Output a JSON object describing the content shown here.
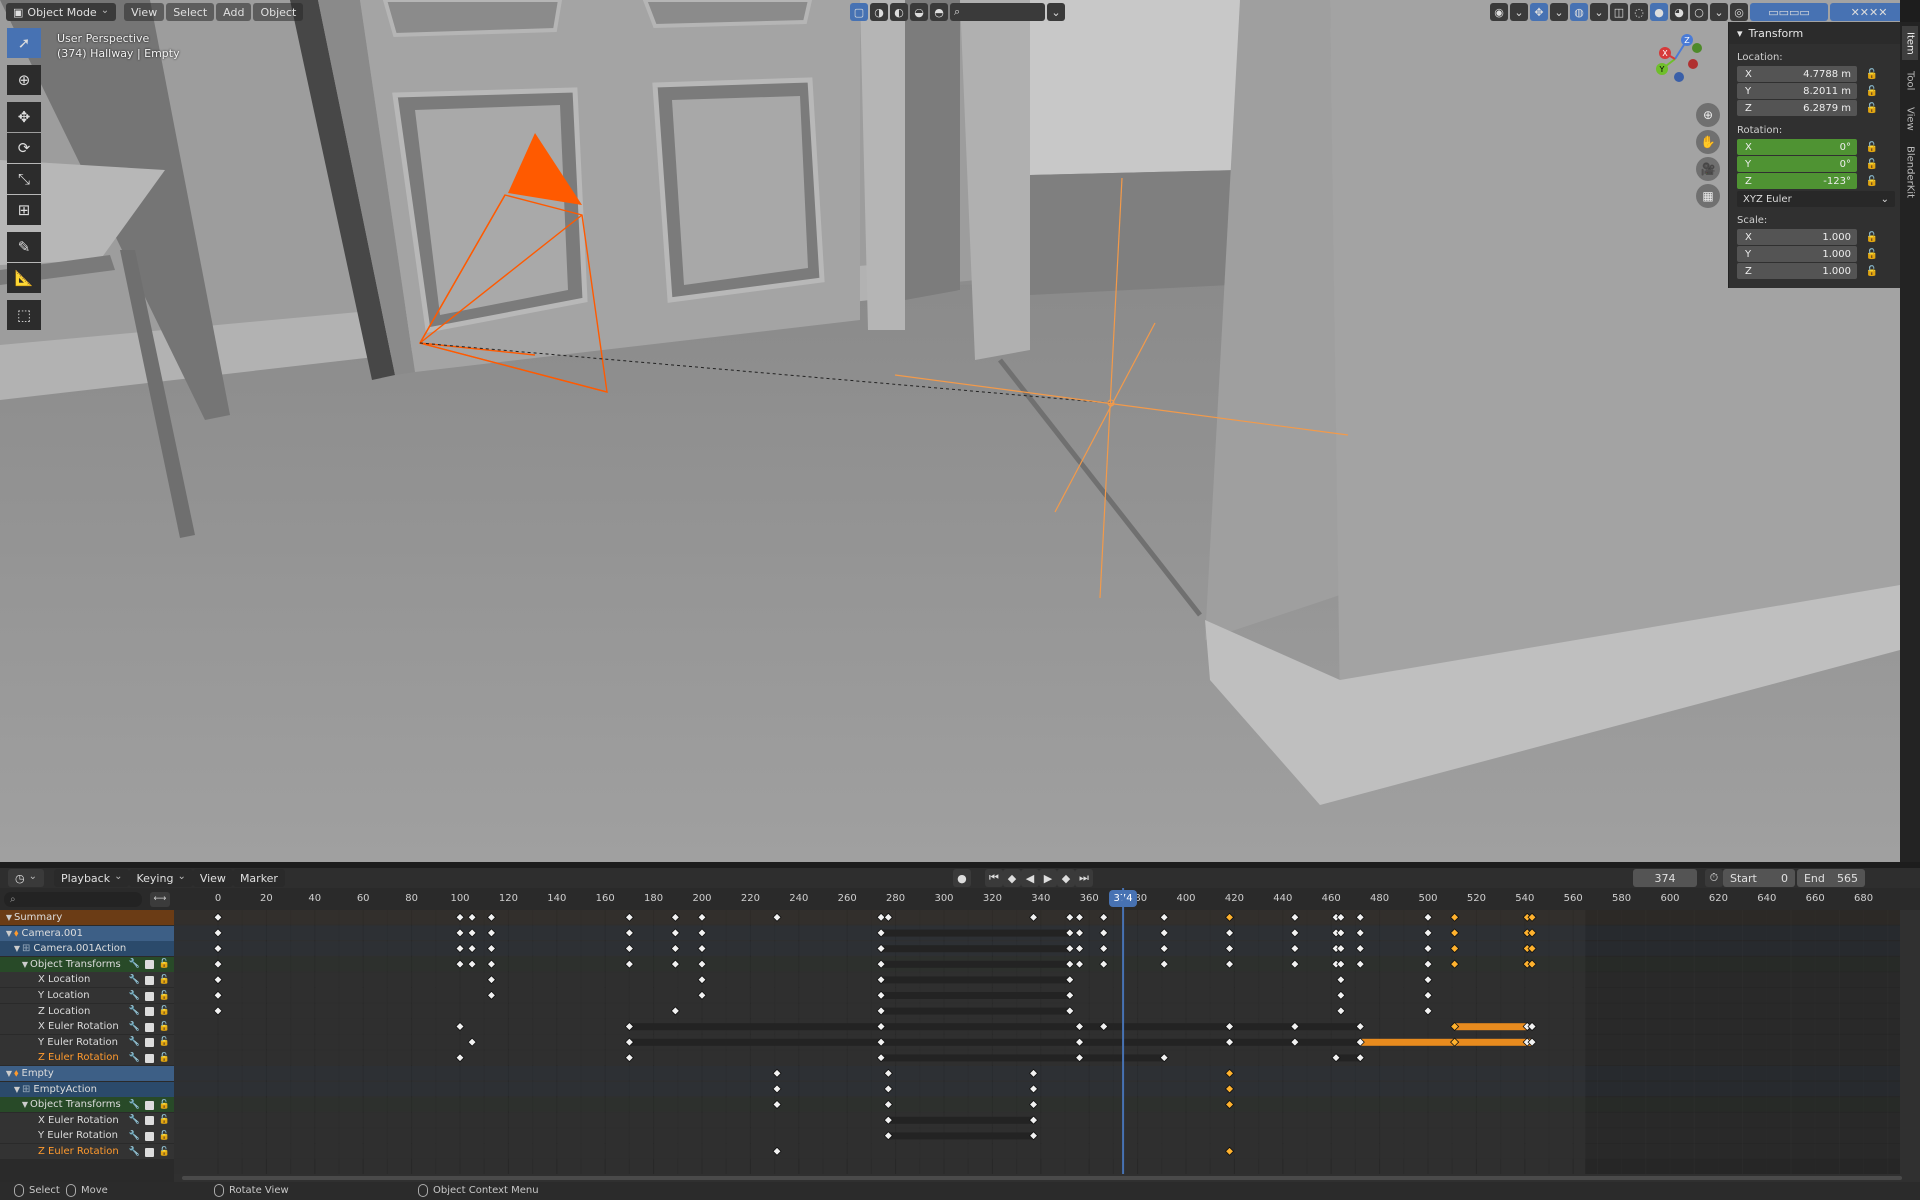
{
  "viewport": {
    "mode_label": "Object Mode",
    "menus": [
      "View",
      "Select",
      "Add",
      "Object"
    ],
    "overlay_line1": "User Perspective",
    "overlay_line2": "(374) Hallway | Empty",
    "tools": [
      "select-box-icon",
      "cursor-icon",
      "move-icon",
      "rotate-icon",
      "scale-icon",
      "transform-icon",
      "annotate-icon",
      "measure-icon",
      "add-cube-icon"
    ],
    "camera_color": "#ff5a00",
    "empty_color": "#f39a4a",
    "gizmo": {
      "z": "Z",
      "y": "Y",
      "x": "X"
    }
  },
  "npanel": {
    "title": "Transform",
    "location_label": "Location:",
    "location": [
      {
        "axis": "X",
        "value": "4.7788 m"
      },
      {
        "axis": "Y",
        "value": "8.2011 m"
      },
      {
        "axis": "Z",
        "value": "6.2879 m"
      }
    ],
    "rotation_label": "Rotation:",
    "rotation": [
      {
        "axis": "X",
        "value": "0°"
      },
      {
        "axis": "Y",
        "value": "0°"
      },
      {
        "axis": "Z",
        "value": "-123°"
      }
    ],
    "rotation_mode": "XYZ Euler",
    "scale_label": "Scale:",
    "scale": [
      {
        "axis": "X",
        "value": "1.000"
      },
      {
        "axis": "Y",
        "value": "1.000"
      },
      {
        "axis": "Z",
        "value": "1.000"
      }
    ],
    "tabs": [
      "Item",
      "Tool",
      "View",
      "BlenderKit"
    ]
  },
  "dopesheet": {
    "menus": [
      "Playback",
      "Keying",
      "View",
      "Marker"
    ],
    "current_frame": "374",
    "start_label": "Start",
    "start": "0",
    "end_label": "End",
    "end": "565",
    "ruler_ticks": [
      "0",
      "20",
      "40",
      "60",
      "80",
      "100",
      "120",
      "140",
      "160",
      "180",
      "200",
      "220",
      "240",
      "260",
      "280",
      "300",
      "320",
      "340",
      "360",
      "380",
      "400",
      "420",
      "440",
      "460",
      "480",
      "500",
      "520",
      "540",
      "560",
      "580",
      "600",
      "620",
      "640",
      "660",
      "680"
    ],
    "playhead_label": "374",
    "channels": [
      {
        "label": "Summary",
        "kind": "summary",
        "indent": 0
      },
      {
        "label": "Camera.001",
        "kind": "object",
        "indent": 0
      },
      {
        "label": "Camera.001Action",
        "kind": "action",
        "indent": 1
      },
      {
        "label": "Object Transforms",
        "kind": "group",
        "indent": 2
      },
      {
        "label": "X Location",
        "kind": "curve",
        "indent": 3
      },
      {
        "label": "Y Location",
        "kind": "curve",
        "indent": 3
      },
      {
        "label": "Z Location",
        "kind": "curve",
        "indent": 3
      },
      {
        "label": "X Euler Rotation",
        "kind": "curve",
        "indent": 3
      },
      {
        "label": "Y Euler Rotation",
        "kind": "curve",
        "indent": 3
      },
      {
        "label": "Z Euler Rotation",
        "kind": "curve-orange",
        "indent": 3
      },
      {
        "label": "Empty",
        "kind": "object",
        "indent": 0
      },
      {
        "label": "EmptyAction",
        "kind": "action",
        "indent": 1
      },
      {
        "label": "Object Transforms",
        "kind": "group",
        "indent": 2
      },
      {
        "label": "X Euler Rotation",
        "kind": "curve",
        "indent": 3
      },
      {
        "label": "Y Euler Rotation",
        "kind": "curve",
        "indent": 3
      },
      {
        "label": "Z Euler Rotation",
        "kind": "curve-orange",
        "indent": 3
      }
    ],
    "keys": [
      [
        0,
        100,
        105,
        113,
        170,
        189,
        200,
        231,
        274,
        277,
        337,
        352,
        356,
        366,
        391,
        418,
        445,
        462,
        464,
        472,
        500,
        511,
        541,
        543
      ],
      [
        0,
        100,
        105,
        113,
        170,
        189,
        200,
        274,
        352,
        356,
        366,
        391,
        418,
        445,
        462,
        464,
        472,
        500,
        511,
        541,
        543
      ],
      [
        0,
        100,
        105,
        113,
        170,
        189,
        200,
        274,
        352,
        356,
        366,
        391,
        418,
        445,
        462,
        464,
        472,
        500,
        511,
        541,
        543
      ],
      [
        0,
        100,
        105,
        113,
        170,
        189,
        200,
        274,
        352,
        356,
        366,
        391,
        418,
        445,
        462,
        464,
        472,
        500,
        511,
        541,
        543
      ],
      [
        0,
        113,
        200,
        274,
        352,
        464,
        500
      ],
      [
        0,
        113,
        200,
        274,
        352,
        464,
        500
      ],
      [
        0,
        189,
        274,
        352,
        464,
        500
      ],
      [
        100,
        170,
        274,
        356,
        366,
        418,
        445,
        472,
        511,
        541,
        543
      ],
      [
        105,
        170,
        274,
        356,
        418,
        445,
        472,
        511,
        541,
        543
      ],
      [
        100,
        170,
        274,
        356,
        391,
        462,
        472
      ],
      [
        231,
        277,
        337,
        418
      ],
      [
        231,
        277,
        337,
        418
      ],
      [
        231,
        277,
        337,
        418
      ],
      [
        277,
        337
      ],
      [
        277,
        337
      ],
      [
        231,
        418
      ]
    ],
    "selected_keys": {
      "0": [
        418,
        511,
        541,
        543
      ],
      "1": [
        511,
        541,
        543
      ],
      "2": [
        511,
        541,
        543
      ],
      "3": [
        511,
        541,
        543
      ],
      "7": [
        511
      ],
      "8": [
        511
      ],
      "10": [
        418
      ],
      "11": [
        418
      ],
      "12": [
        418
      ],
      "15": [
        418
      ]
    },
    "holds": [
      {
        "row": 1,
        "from": 274,
        "to": 352,
        "color": "#232323"
      },
      {
        "row": 2,
        "from": 274,
        "to": 352,
        "color": "#232323"
      },
      {
        "row": 3,
        "from": 274,
        "to": 352,
        "color": "#232323"
      },
      {
        "row": 4,
        "from": 274,
        "to": 352,
        "color": "#232323"
      },
      {
        "row": 5,
        "from": 274,
        "to": 352,
        "color": "#232323"
      },
      {
        "row": 6,
        "from": 274,
        "to": 352,
        "color": "#232323"
      },
      {
        "row": 7,
        "from": 170,
        "to": 274,
        "color": "#232323"
      },
      {
        "row": 7,
        "from": 274,
        "to": 472,
        "color": "#232323"
      },
      {
        "row": 7,
        "from": 511,
        "to": 541,
        "color": "#e88b1e"
      },
      {
        "row": 8,
        "from": 170,
        "to": 274,
        "color": "#232323"
      },
      {
        "row": 8,
        "from": 274,
        "to": 472,
        "color": "#232323"
      },
      {
        "row": 8,
        "from": 472,
        "to": 543,
        "color": "#e88b1e"
      },
      {
        "row": 9,
        "from": 274,
        "to": 391,
        "color": "#232323"
      },
      {
        "row": 9,
        "from": 462,
        "to": 472,
        "color": "#232323"
      },
      {
        "row": 13,
        "from": 277,
        "to": 337,
        "color": "#232323"
      },
      {
        "row": 14,
        "from": 277,
        "to": 337,
        "color": "#232323"
      }
    ],
    "accent": "#4772b3",
    "selected_key_color": "#ffb22e"
  },
  "statusbar": {
    "select": "Select",
    "move": "Move",
    "rotate_view": "Rotate View",
    "context_menu": "Object Context Menu"
  }
}
